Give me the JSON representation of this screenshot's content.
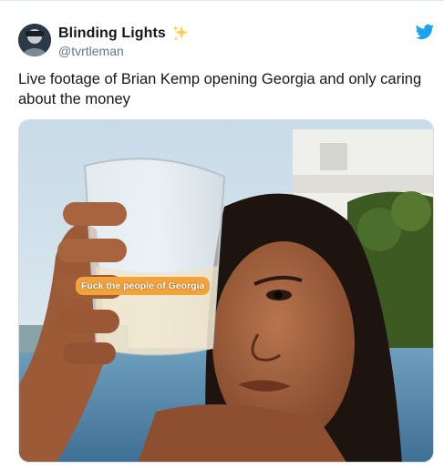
{
  "tweet": {
    "author": {
      "display_name": "Blinding Lights",
      "handle": "@tvrtleman",
      "name_emoji_icon": "sparkles-icon"
    },
    "text": "Live footage of Brian Kemp opening Georgia and only caring about the money",
    "media": {
      "caption": "Fuck the people of Georgia"
    },
    "brand_icon": "twitter-bird-icon",
    "colors": {
      "twitter_blue": "#1da1f2",
      "handle_gray": "#657786",
      "caption_orange": "#f2a33a"
    }
  }
}
